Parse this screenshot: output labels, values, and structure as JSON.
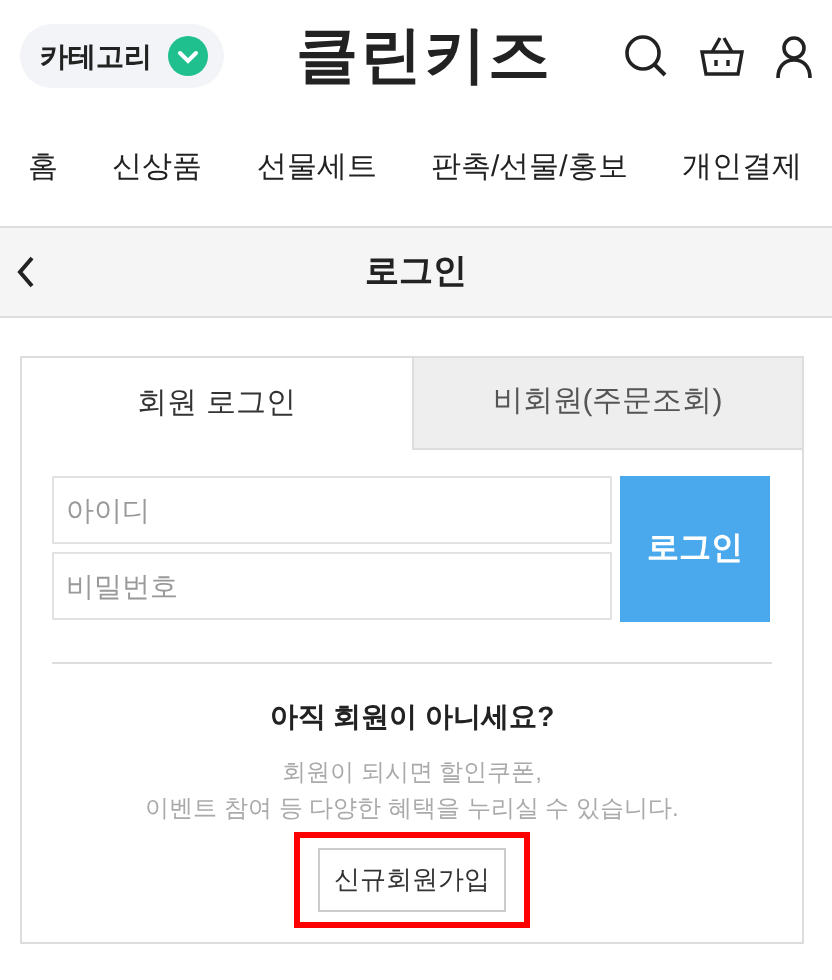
{
  "header": {
    "category_label": "카테고리",
    "logo": "클린키즈"
  },
  "nav": [
    {
      "label": "홈"
    },
    {
      "label": "신상품"
    },
    {
      "label": "선물세트"
    },
    {
      "label": "판촉/선물/홍보"
    },
    {
      "label": "개인결제"
    }
  ],
  "title_bar": {
    "title": "로그인"
  },
  "tabs": [
    {
      "label": "회원 로그인",
      "selected": true
    },
    {
      "label": "비회원(주문조회)",
      "selected": false
    }
  ],
  "login_form": {
    "id_field": {
      "placeholder": "아이디"
    },
    "password_field": {
      "placeholder": "비밀번호"
    },
    "submit": "로그인"
  },
  "signup": {
    "question": "아직 회원이 아니세요?",
    "description": "회원이 되시면 할인쿠폰,\n이벤트 참여 등 다양한 혜택을 누리실 수 있습니다.",
    "button": "신규회원가입",
    "highlighted": true
  }
}
